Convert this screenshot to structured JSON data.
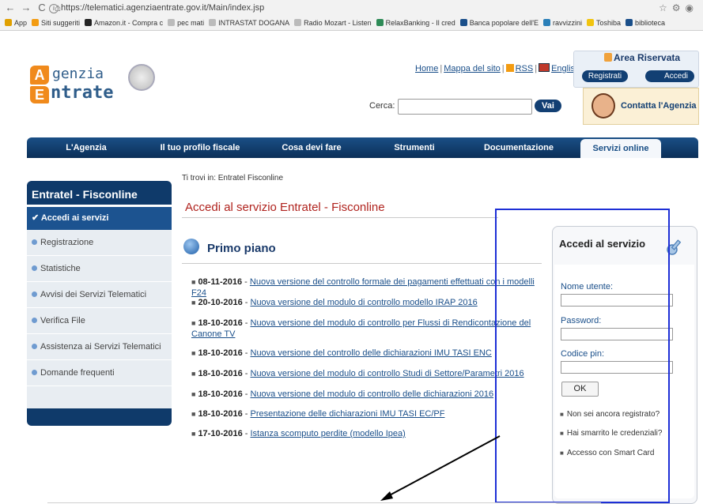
{
  "browser": {
    "url": "https://telematici.agenziaentrate.gov.it/Main/index.jsp",
    "bookmarks": [
      {
        "label": "App",
        "color": "#e0a000"
      },
      {
        "label": "Siti suggeriti",
        "color": "#f39c12"
      },
      {
        "label": "Amazon.it - Compra c",
        "color": "#222222"
      },
      {
        "label": "pec mati",
        "color": "#bbbbbb"
      },
      {
        "label": "INTRASTAT DOGANA",
        "color": "#bbbbbb"
      },
      {
        "label": "Radio Mozart - Listen",
        "color": "#bbbbbb"
      },
      {
        "label": "RelaxBanking - Il cred",
        "color": "#2e8b57"
      },
      {
        "label": "Banca popolare dell'E",
        "color": "#1a4f8a"
      },
      {
        "label": "ravvizzini",
        "color": "#2a7fb8"
      },
      {
        "label": "Toshiba",
        "color": "#f1c40f"
      },
      {
        "label": "biblioteca",
        "color": "#1a4f8a"
      }
    ]
  },
  "logo": {
    "line1": "genzia",
    "line2": "ntrate",
    "a": "A",
    "e": "E"
  },
  "top_links": {
    "home": "Home",
    "sitemap": "Mappa del sito",
    "rss": "RSS",
    "english": "English",
    "sep": "|"
  },
  "area_riservata": {
    "title": "Area Riservata",
    "register": "Registrati",
    "login": "Accedi"
  },
  "search": {
    "label": "Cerca:",
    "button": "Vai",
    "value": ""
  },
  "contact": {
    "label": "Contatta l'Agenzia"
  },
  "main_nav": [
    {
      "label": "L'Agenzia",
      "active": false
    },
    {
      "label": "Il tuo profilo fiscale",
      "active": false
    },
    {
      "label": "Cosa devi fare",
      "active": false
    },
    {
      "label": "Strumenti",
      "active": false
    },
    {
      "label": "Documentazione",
      "active": false
    },
    {
      "label": "Servizi online",
      "active": true
    }
  ],
  "breadcrumb": "Ti trovi in: Entratel Fisconline",
  "sidebar": {
    "title": "Entratel - Fisconline",
    "active": "✔ Accedi ai servizi",
    "items": [
      "Registrazione",
      "Statistiche",
      "Avvisi dei Servizi Telematici",
      "Verifica File",
      "Assistenza ai Servizi Telematici",
      "Domande frequenti"
    ]
  },
  "page_title": "Accedi al servizio Entratel - Fisconline",
  "primo_piano": {
    "title": "Primo piano",
    "news": [
      {
        "date": "08-11-2016",
        "text": "Nuova versione del controllo formale dei pagamenti effettuati con i modelli F24"
      },
      {
        "date": "20-10-2016",
        "text": "Nuova versione del modulo di controllo modello IRAP 2016"
      },
      {
        "date": "18-10-2016",
        "text": "Nuova versione del modulo di controllo per Flussi di Rendicontazione del Canone TV"
      },
      {
        "date": "18-10-2016",
        "text": "Nuova versione del controllo delle dichiarazioni IMU TASI ENC"
      },
      {
        "date": "18-10-2016",
        "text": "Nuova versione del modulo di controllo Studi di Settore/Parametri 2016"
      },
      {
        "date": "18-10-2016",
        "text": "Nuova versione del modulo di controllo delle dichiarazioni 2016"
      },
      {
        "date": "18-10-2016",
        "text": "Presentazione delle dichiarazioni IMU TASI EC/PF"
      },
      {
        "date": "17-10-2016",
        "text": "Istanza scomputo perdite (modello Ipea)"
      }
    ]
  },
  "login": {
    "title": "Accedi al servizio",
    "username_label": "Nome utente:",
    "password_label": "Password:",
    "pin_label": "Codice pin:",
    "ok": "OK",
    "links": [
      "Non sei ancora registrato?",
      "Hai smarrito le credenziali?",
      "Accesso con Smart Card"
    ]
  },
  "separator": " - ",
  "bullet": "■"
}
